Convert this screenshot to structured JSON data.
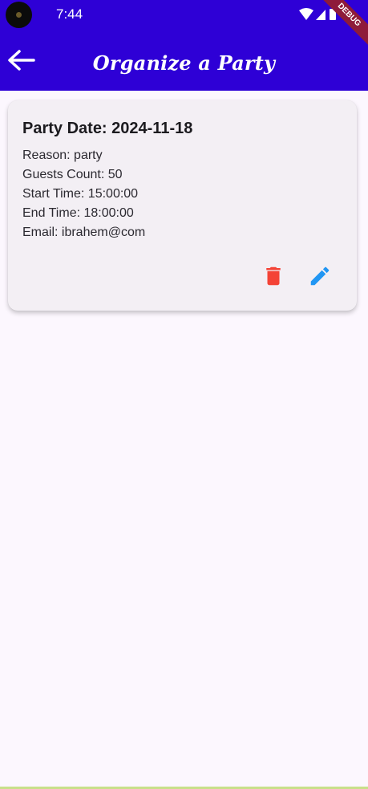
{
  "status_bar": {
    "time": "7:44"
  },
  "app_bar": {
    "title": "Organize a Party",
    "debug_label": "DEBUG"
  },
  "party": {
    "title": "Party Date: 2024-11-18",
    "reason": "Reason: party",
    "guests": "Guests Count: 50",
    "start": "Start Time: 15:00:00",
    "end": "End Time: 18:00:00",
    "email": "Email: ibrahem@com"
  },
  "colors": {
    "appbar": "#2E00D6",
    "delete": "#F44336",
    "edit": "#2196F3",
    "background": "#FCF7FE"
  }
}
